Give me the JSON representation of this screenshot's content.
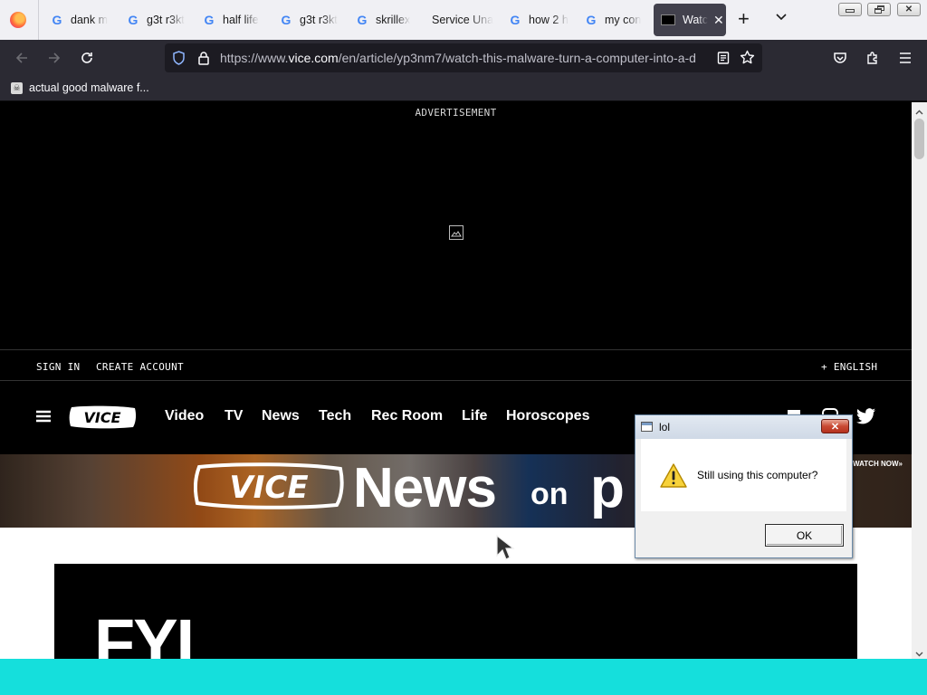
{
  "browser": {
    "tabs": [
      {
        "label": "dank m",
        "icon": "google-icon"
      },
      {
        "label": "g3t r3kt",
        "icon": "google-icon"
      },
      {
        "label": "half life",
        "icon": "google-icon"
      },
      {
        "label": "g3t r3kt",
        "icon": "google-icon"
      },
      {
        "label": "skrillex",
        "icon": "google-icon"
      },
      {
        "label": "Service Una",
        "icon": "none"
      },
      {
        "label": "how 2 h",
        "icon": "google-icon"
      },
      {
        "label": "my con",
        "icon": "google-icon"
      },
      {
        "label": "Watc",
        "icon": "vice-icon",
        "active": true
      }
    ],
    "url": {
      "prefix": "https://www.",
      "host": "vice.com",
      "path": "/en/article/yp3nm7/watch-this-malware-turn-a-computer-into-a-d"
    },
    "bookmarks": [
      {
        "label": "actual good malware f..."
      }
    ]
  },
  "page": {
    "ad_label": "ADVERTISEMENT",
    "sign_in": "SIGN IN",
    "create_account": "CREATE ACCOUNT",
    "language": "+ ENGLISH",
    "logo": "VICE",
    "nav": [
      "Video",
      "TV",
      "News",
      "Tech",
      "Rec Room",
      "Life",
      "Horoscopes"
    ],
    "banner": {
      "logo": "VICE",
      "word": "News",
      "on": "on",
      "rest": "p",
      "cta": "WATCH NOW»"
    },
    "article_heading": "FYI"
  },
  "dialog": {
    "title": "lol",
    "message": "Still using this computer?",
    "ok_label": "OK"
  },
  "colors": {
    "taskbar": "#15dfdc",
    "browser_chrome": "#2b2a33",
    "tab_strip": "#f0f0f4"
  }
}
